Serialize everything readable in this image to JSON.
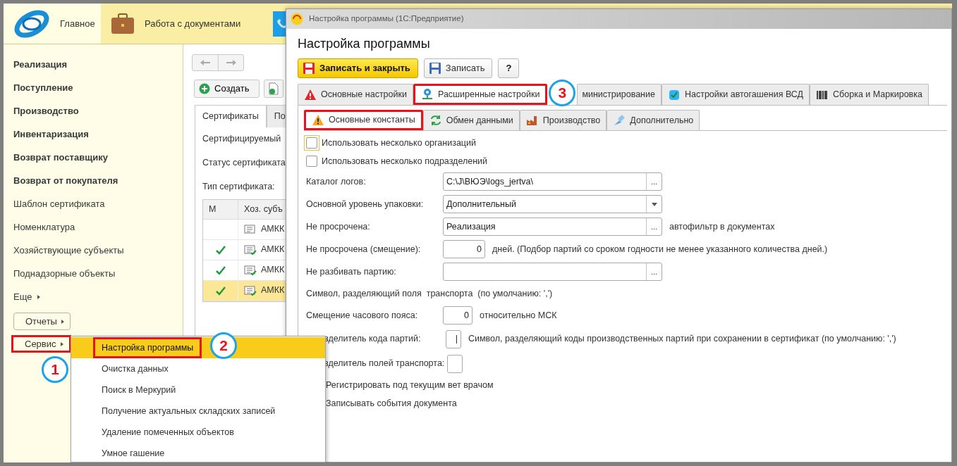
{
  "top_sections": [
    {
      "label": "Главное",
      "selected": true
    },
    {
      "label": "Работа с документами",
      "selected": false
    },
    {
      "selected": false
    }
  ],
  "sidebar": {
    "items": [
      {
        "label": "Реализация",
        "kind": "bold"
      },
      {
        "label": "Поступление",
        "kind": "bold"
      },
      {
        "label": "Производство",
        "kind": "bold"
      },
      {
        "label": "Инвентаризация",
        "kind": "bold"
      },
      {
        "label": "Возврат поставщику",
        "kind": "bold"
      },
      {
        "label": "Возврат от покупателя",
        "kind": "bold"
      },
      {
        "label": "Шаблон сертификата",
        "kind": "plain"
      },
      {
        "label": "Номенклатура",
        "kind": "plain"
      },
      {
        "label": "Хозяйствующие субъекты",
        "kind": "plain"
      },
      {
        "label": "Поднадзорные объекты",
        "kind": "plain"
      },
      {
        "label": "Еще",
        "kind": "more"
      }
    ],
    "buttons": [
      {
        "label": "Отчеты",
        "highlighted": false
      },
      {
        "label": "Сервис",
        "highlighted": true,
        "marker": "1"
      }
    ]
  },
  "create_button": "Создать",
  "tabs": [
    {
      "label": "Сертификаты",
      "selected": true
    },
    {
      "label": "По",
      "selected": false
    }
  ],
  "form_labels": [
    "Сертифицируемый",
    "Статус сертификата",
    "Тип сертификата:"
  ],
  "table": {
    "columns": [
      "М",
      "Хоз. субъ"
    ],
    "rows": [
      {
        "checked": false,
        "cell": "АМКК",
        "selected": false
      },
      {
        "checked": true,
        "cell": "АМКК",
        "selected": false
      },
      {
        "checked": true,
        "cell": "АМКК",
        "selected": false
      },
      {
        "checked": true,
        "cell": "АМКК",
        "selected": true
      }
    ]
  },
  "menu": {
    "items": [
      {
        "label": "Настройка программы",
        "selected": true,
        "highlighted": true,
        "marker": "2"
      },
      {
        "label": "Очистка данных",
        "selected": false,
        "highlighted": false
      },
      {
        "label": "Поиск в Меркурий",
        "selected": false,
        "highlighted": false
      },
      {
        "label": "Получение актуальных складских записей",
        "selected": false,
        "highlighted": false
      },
      {
        "label": "Удаление помеченных объектов",
        "selected": false,
        "highlighted": false
      },
      {
        "label": "Умное гашение",
        "selected": false,
        "highlighted": false
      }
    ]
  },
  "dialog": {
    "title": "Настройка программы (1С:Предприятие)",
    "heading": "Настройка программы",
    "buttons": [
      {
        "label": "Записать и закрыть",
        "kind": "primary"
      },
      {
        "label": "Записать",
        "kind": "save"
      },
      {
        "label": "?",
        "kind": "help"
      }
    ],
    "tabs": [
      {
        "label": "Основные настройки",
        "selected": false,
        "highlighted": false,
        "cut": false
      },
      {
        "label": "Расширенные настройки",
        "selected": true,
        "highlighted": true,
        "cut": false,
        "marker": "3"
      },
      {
        "label": "министрирование",
        "selected": false,
        "highlighted": false,
        "cut": true
      },
      {
        "label": "Настройки автогашения ВСД",
        "selected": false,
        "highlighted": false,
        "cut": false
      },
      {
        "label": "Сборка и Маркировка",
        "selected": false,
        "highlighted": false,
        "cut": false
      }
    ],
    "subtabs": [
      {
        "label": "Основные константы",
        "selected": true,
        "highlighted": true
      },
      {
        "label": "Обмен данными",
        "selected": false,
        "highlighted": false
      },
      {
        "label": "Производство",
        "selected": false,
        "highlighted": false
      },
      {
        "label": "Дополнительно",
        "selected": false,
        "highlighted": false
      }
    ],
    "settings": [
      {
        "kind": "checkbox",
        "label": "Использовать несколько организаций",
        "checked": false,
        "focused": true
      },
      {
        "kind": "checkbox",
        "label": "Использовать несколько подразделений",
        "checked": false,
        "focused": false
      },
      {
        "kind": "choice",
        "label": "Каталог логов:",
        "value": "C:\\J\\ВЮЭ\\logs_jertva\\",
        "button": "..."
      },
      {
        "kind": "select",
        "label": "Основной уровень упаковки:",
        "value": "Дополнительный"
      },
      {
        "kind": "choice",
        "label": "Не просрочена:",
        "value": "Реализация",
        "button": "...",
        "note": "автофильтр в документах"
      },
      {
        "kind": "number",
        "label": "Не просрочена (смещение):",
        "value": "0",
        "note": "дней. (Подбор партий со сроком годности не менее указанного количества дней.)"
      },
      {
        "kind": "choice",
        "label": "Не разбивать партию:",
        "button": "..."
      },
      {
        "kind": "text",
        "label": "Символ, разделяющий поля  транспорта  (по умолчанию: ',')"
      },
      {
        "kind": "short-number",
        "label": "Смещение часового пояса:",
        "value": "0",
        "note": "относительно МСК"
      },
      {
        "kind": "char",
        "label": "зделитель кода партий:",
        "value": "|",
        "cut": true,
        "note": "Символ, разделяющий коды производственных партий при сохранении в сертификат (по умолчанию: ',')"
      },
      {
        "kind": "char",
        "label": "зделитель полей транспорта:",
        "cut": true
      },
      {
        "kind": "checkbox-label",
        "label": "Регистрировать под текущим вет врачом"
      },
      {
        "kind": "checkbox-label",
        "label": "Записывать события документа"
      }
    ]
  }
}
